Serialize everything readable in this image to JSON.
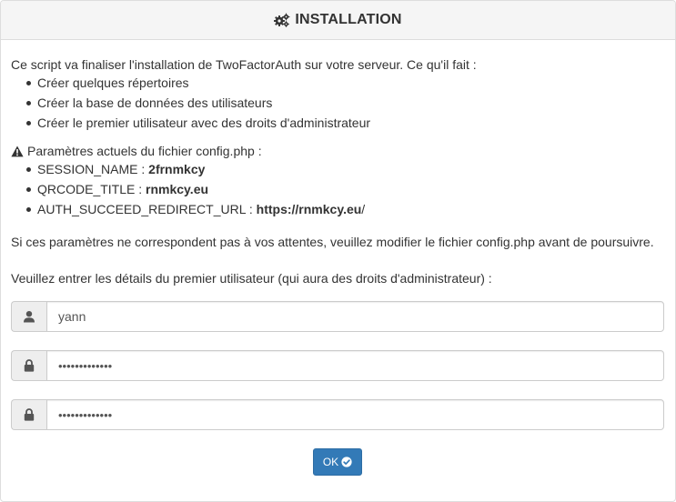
{
  "header": {
    "title": "INSTALLATION",
    "icon": "gears-icon"
  },
  "intro": {
    "text": "Ce script va finaliser l'installation de TwoFactorAuth sur votre serveur. Ce qu'il fait :",
    "steps": [
      "Créer quelques répertoires",
      "Créer la base de données des utilisateurs",
      "Créer le premier utilisateur avec des droits d'administrateur"
    ]
  },
  "config": {
    "heading": "Paramètres actuels du fichier config.php :",
    "icon": "warning-icon",
    "params": [
      {
        "key": "SESSION_NAME : ",
        "value_bold": "2frnmkcy",
        "value_tail": ""
      },
      {
        "key": "QRCODE_TITLE : ",
        "value_bold": "rnmkcy.eu",
        "value_tail": ""
      },
      {
        "key": "AUTH_SUCCEED_REDIRECT_URL : ",
        "value_bold": "https://rnmkcy.eu",
        "value_tail": "/"
      }
    ]
  },
  "note": "Si ces paramètres ne correspondent pas à vos attentes, veuillez modifier le fichier config.php avant de poursuivre.",
  "ask": "Veuillez entrer les détails du premier utilisateur (qui aura des droits d'administrateur) :",
  "form": {
    "username": {
      "value": "yann",
      "icon": "user-icon"
    },
    "password": {
      "value": "•••••••••••••",
      "icon": "lock-icon"
    },
    "password_confirm": {
      "value": "•••••••••••••",
      "icon": "lock-icon"
    },
    "submit_label": "OK",
    "submit_icon": "check-circle-icon"
  },
  "colors": {
    "primary": "#337ab7",
    "heading_bg": "#f5f5f5",
    "addon_bg": "#eeeeee",
    "text": "#333333"
  }
}
